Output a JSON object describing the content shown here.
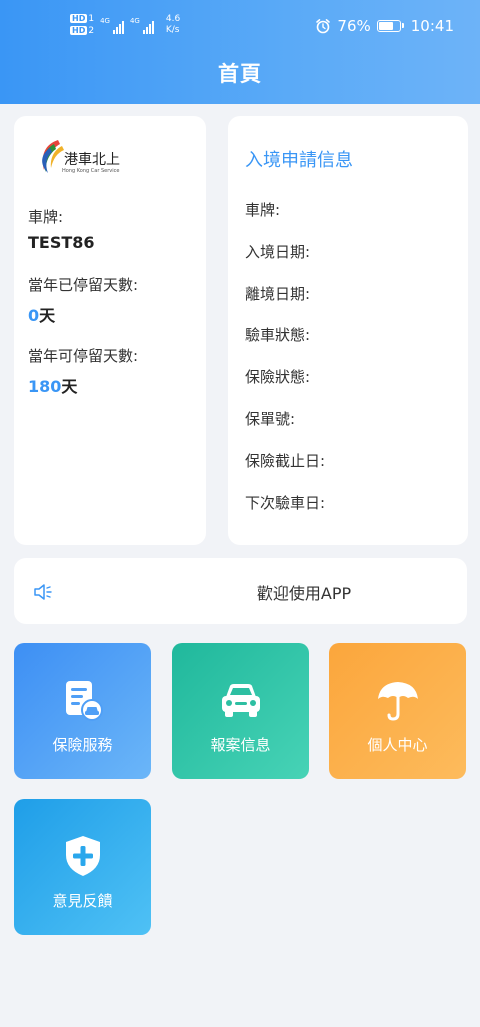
{
  "status_bar": {
    "hd1": "HD",
    "hd1_sub": "1",
    "hd2": "HD",
    "hd2_sub": "2",
    "net1": "4G",
    "net2": "4G",
    "speed_value": "4.6",
    "speed_unit": "K/s",
    "battery": "76%",
    "battery_level": 0.76,
    "time": "10:41"
  },
  "header": {
    "title": "首頁"
  },
  "vehicle_card": {
    "logo_text": "港車北上",
    "logo_subtext": "Hong Kong Car Service",
    "plate_label": "車牌:",
    "plate_value": "TEST86",
    "stayed_label": "當年已停留天數:",
    "stayed_value": "0",
    "stayed_unit": "天",
    "remain_label": "當年可停留天數:",
    "remain_value": "180",
    "remain_unit": "天"
  },
  "entry_card": {
    "title": "入境申請信息",
    "items": [
      "車牌:",
      "入境日期:",
      "離境日期:",
      "驗車狀態:",
      "保險狀態:",
      "保單號:",
      "保險截止日:",
      "下次驗車日:"
    ]
  },
  "notice": {
    "text": "歡迎使用APP"
  },
  "tiles": [
    {
      "label": "保險服務",
      "icon": "insurance-doc-icon"
    },
    {
      "label": "報案信息",
      "icon": "car-icon"
    },
    {
      "label": "個人中心",
      "icon": "umbrella-icon"
    },
    {
      "label": "意見反饋",
      "icon": "shield-plus-icon"
    }
  ],
  "colors": {
    "accent": "#3a96f5",
    "background": "#f1f3f7"
  }
}
